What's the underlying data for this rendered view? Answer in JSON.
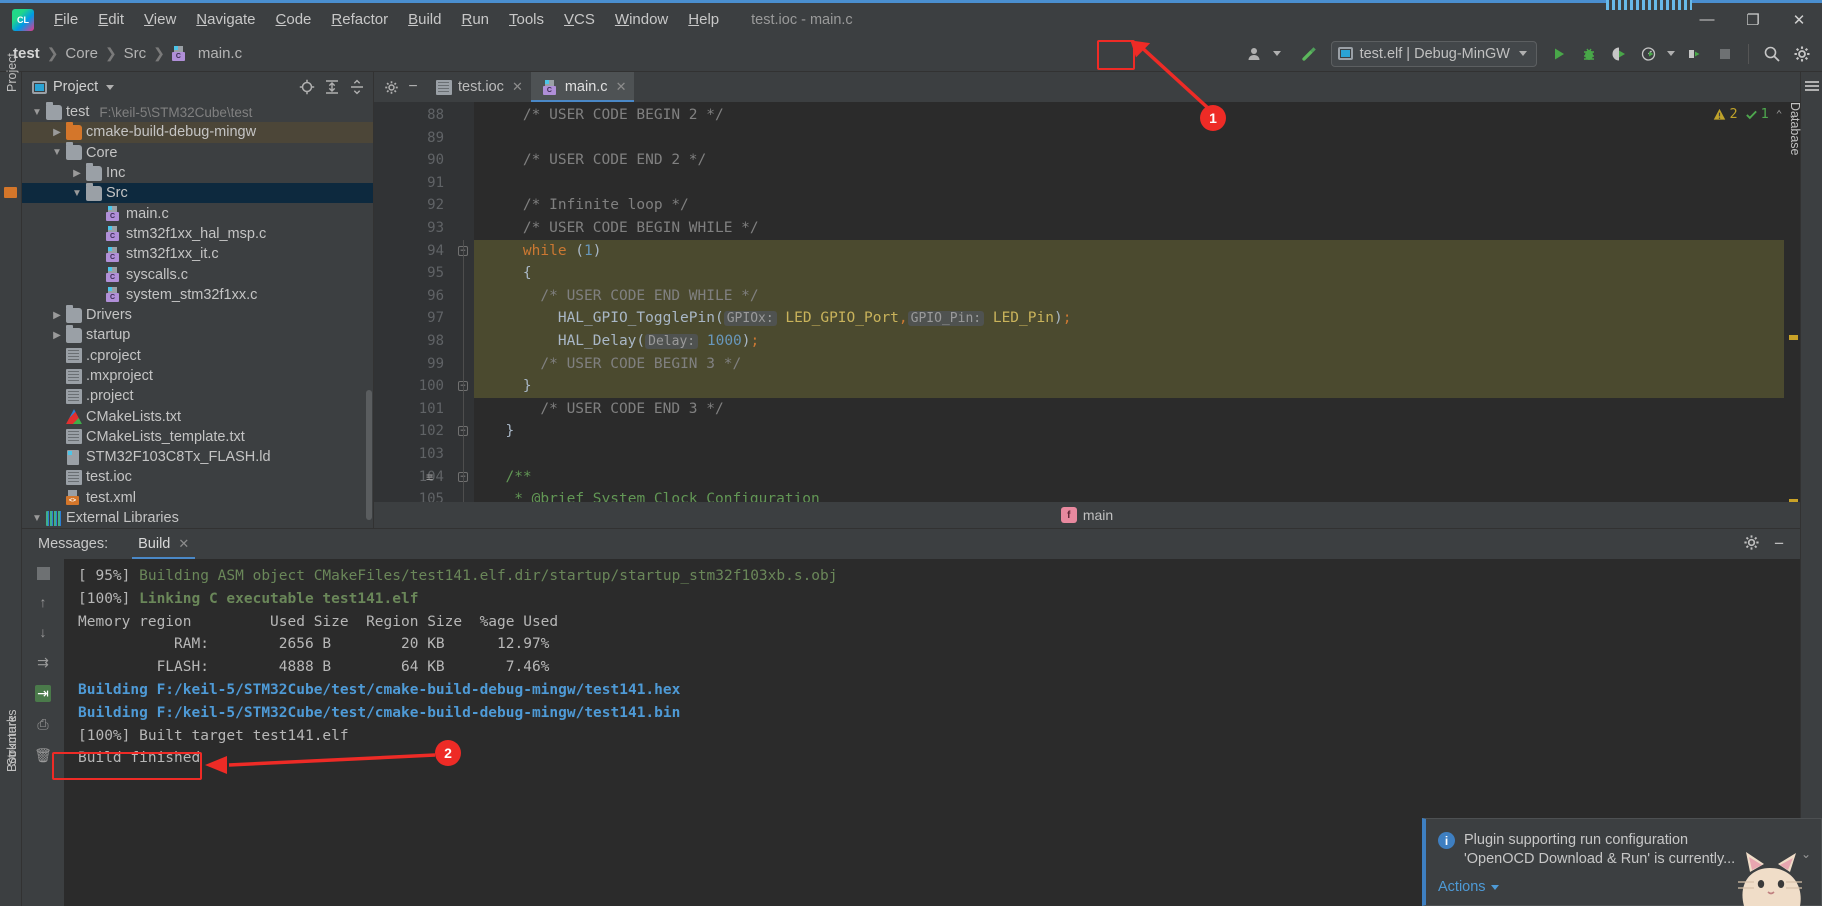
{
  "window": {
    "title": "test.ioc - main.c",
    "minimize": "—",
    "maximize": "❐",
    "close": "✕"
  },
  "menu": {
    "items": [
      "File",
      "Edit",
      "View",
      "Navigate",
      "Code",
      "Refactor",
      "Build",
      "Run",
      "Tools",
      "VCS",
      "Window",
      "Help"
    ]
  },
  "toolbar": {
    "breadcrumbs": [
      "test",
      "Core",
      "Src",
      "main.c"
    ],
    "run_config": "test.elf | Debug-MinGW",
    "icons": {
      "user_icon": "user-avatar",
      "build_hammer": "hammer-icon",
      "run": "run-icon",
      "debug": "debug-icon",
      "run_coverage": "run-with-coverage-icon",
      "profile": "profiler-icon",
      "attach": "attach-icon",
      "stop": "stop-icon",
      "search": "search-icon",
      "settings": "gear-icon"
    }
  },
  "sidebar_left": {
    "labels": [
      "Project",
      "Structure",
      "Bookmarks"
    ]
  },
  "sidebar_right": {
    "labels": [
      "Database"
    ]
  },
  "project_panel": {
    "title": "Project",
    "tree": [
      {
        "label": "test",
        "path": "F:\\keil-5\\STM32Cube\\test",
        "icon": "folder",
        "indent": 0,
        "arrow": "v",
        "state": "normal"
      },
      {
        "label": "cmake-build-debug-mingw",
        "path": "",
        "icon": "folder-orange",
        "indent": 1,
        "arrow": ">",
        "state": "highlight"
      },
      {
        "label": "Core",
        "path": "",
        "icon": "folder",
        "indent": 1,
        "arrow": "v",
        "state": "normal"
      },
      {
        "label": "Inc",
        "path": "",
        "icon": "folder",
        "indent": 2,
        "arrow": ">",
        "state": "normal"
      },
      {
        "label": "Src",
        "path": "",
        "icon": "folder",
        "indent": 2,
        "arrow": "v",
        "state": "selected"
      },
      {
        "label": "main.c",
        "path": "",
        "icon": "c-file",
        "indent": 3,
        "arrow": "",
        "state": "normal"
      },
      {
        "label": "stm32f1xx_hal_msp.c",
        "path": "",
        "icon": "c-file",
        "indent": 3,
        "arrow": "",
        "state": "normal"
      },
      {
        "label": "stm32f1xx_it.c",
        "path": "",
        "icon": "c-file",
        "indent": 3,
        "arrow": "",
        "state": "normal"
      },
      {
        "label": "syscalls.c",
        "path": "",
        "icon": "c-file",
        "indent": 3,
        "arrow": "",
        "state": "normal"
      },
      {
        "label": "system_stm32f1xx.c",
        "path": "",
        "icon": "c-file",
        "indent": 3,
        "arrow": "",
        "state": "normal"
      },
      {
        "label": "Drivers",
        "path": "",
        "icon": "folder",
        "indent": 1,
        "arrow": ">",
        "state": "normal"
      },
      {
        "label": "startup",
        "path": "",
        "icon": "folder",
        "indent": 1,
        "arrow": ">",
        "state": "normal"
      },
      {
        "label": ".cproject",
        "path": "",
        "icon": "txt-file",
        "indent": 1,
        "arrow": "",
        "state": "normal"
      },
      {
        "label": ".mxproject",
        "path": "",
        "icon": "txt-file",
        "indent": 1,
        "arrow": "",
        "state": "normal"
      },
      {
        "label": ".project",
        "path": "",
        "icon": "txt-file",
        "indent": 1,
        "arrow": "",
        "state": "normal"
      },
      {
        "label": "CMakeLists.txt",
        "path": "",
        "icon": "cmake-file",
        "indent": 1,
        "arrow": "",
        "state": "normal"
      },
      {
        "label": "CMakeLists_template.txt",
        "path": "",
        "icon": "txt-file",
        "indent": 1,
        "arrow": "",
        "state": "normal"
      },
      {
        "label": "STM32F103C8Tx_FLASH.ld",
        "path": "",
        "icon": "ld-file",
        "indent": 1,
        "arrow": "",
        "state": "normal"
      },
      {
        "label": "test.ioc",
        "path": "",
        "icon": "txt-file",
        "indent": 1,
        "arrow": "",
        "state": "normal"
      },
      {
        "label": "test.xml",
        "path": "",
        "icon": "xml-file",
        "indent": 1,
        "arrow": "",
        "state": "normal"
      },
      {
        "label": "External Libraries",
        "path": "",
        "icon": "library",
        "indent": 0,
        "arrow": "v",
        "state": "normal"
      }
    ]
  },
  "editor": {
    "tabs": [
      {
        "label": "test.ioc",
        "icon": "ioc-file-icon",
        "active": false
      },
      {
        "label": "main.c",
        "icon": "c-file-icon",
        "active": true
      }
    ],
    "inspection": {
      "warnings": "2",
      "ok": "1",
      "warn_icon": "warning-triangle-icon",
      "ok_icon": "check-icon"
    },
    "breadcrumb_symbol": "main",
    "first_line": 88,
    "lines": [
      {
        "n": 88,
        "indent": 4,
        "tokens": [
          {
            "t": "/* USER CODE BEGIN 2 */",
            "c": "cmt"
          }
        ]
      },
      {
        "n": 89,
        "indent": 0,
        "tokens": []
      },
      {
        "n": 90,
        "indent": 4,
        "tokens": [
          {
            "t": "/* USER CODE END 2 */",
            "c": "cmt"
          }
        ]
      },
      {
        "n": 91,
        "indent": 0,
        "tokens": []
      },
      {
        "n": 92,
        "indent": 4,
        "tokens": [
          {
            "t": "/* Infinite loop */",
            "c": "cmt"
          }
        ]
      },
      {
        "n": 93,
        "indent": 4,
        "tokens": [
          {
            "t": "/* USER CODE BEGIN WHILE */",
            "c": "cmt"
          }
        ]
      },
      {
        "n": 94,
        "indent": 4,
        "tokens": [
          {
            "t": "while",
            "c": "kw"
          },
          {
            "t": " (",
            "c": "punc"
          },
          {
            "t": "1",
            "c": "num"
          },
          {
            "t": ")",
            "c": "punc"
          }
        ]
      },
      {
        "n": 95,
        "indent": 4,
        "tokens": [
          {
            "t": "{",
            "c": "punc"
          }
        ]
      },
      {
        "n": 96,
        "indent": 6,
        "tokens": [
          {
            "t": "/* USER CODE END WHILE */",
            "c": "cmt"
          }
        ]
      },
      {
        "n": 97,
        "indent": 8,
        "tokens": [
          {
            "t": "HAL_GPIO_TogglePin",
            "c": "fn"
          },
          {
            "t": "(",
            "c": "punc"
          },
          {
            "t": "GPIOx:",
            "c": "hint"
          },
          {
            "t": "LED_GPIO_Port",
            "c": "const"
          },
          {
            "t": ",",
            "c": "kw"
          },
          {
            "t": "GPIO_Pin:",
            "c": "hint"
          },
          {
            "t": "LED_Pin",
            "c": "const"
          },
          {
            "t": ")",
            "c": "punc"
          },
          {
            "t": ";",
            "c": "kw"
          }
        ]
      },
      {
        "n": 98,
        "indent": 8,
        "tokens": [
          {
            "t": "HAL_Delay",
            "c": "fn"
          },
          {
            "t": "(",
            "c": "punc"
          },
          {
            "t": "Delay:",
            "c": "hint"
          },
          {
            "t": "1000",
            "c": "num"
          },
          {
            "t": ")",
            "c": "punc"
          },
          {
            "t": ";",
            "c": "kw"
          }
        ]
      },
      {
        "n": 99,
        "indent": 6,
        "tokens": [
          {
            "t": "/* USER CODE BEGIN 3 */",
            "c": "cmt"
          }
        ]
      },
      {
        "n": 100,
        "indent": 4,
        "tokens": [
          {
            "t": "}",
            "c": "punc"
          }
        ]
      },
      {
        "n": 101,
        "indent": 6,
        "tokens": [
          {
            "t": "/* USER CODE END 3 */",
            "c": "cmt"
          }
        ]
      },
      {
        "n": 102,
        "indent": 2,
        "tokens": [
          {
            "t": "}",
            "c": "punc"
          }
        ]
      },
      {
        "n": 103,
        "indent": 0,
        "tokens": []
      },
      {
        "n": 104,
        "indent": 2,
        "tokens": [
          {
            "t": "/**",
            "c": "docm"
          }
        ]
      },
      {
        "n": 105,
        "indent": 3,
        "tokens": [
          {
            "t": "* ",
            "c": "docm"
          },
          {
            "t": "@brief",
            "c": "docm-u"
          },
          {
            "t": " System Clock Configuration",
            "c": "docm"
          }
        ]
      }
    ]
  },
  "build_panel": {
    "messages_label": "Messages:",
    "tab_label": "Build",
    "gear_icon": "gear-icon",
    "minimize_icon": "minimize-icon",
    "lines": [
      {
        "parts": [
          {
            "t": "[ 95%] ",
            "c": "c-plain"
          },
          {
            "t": "Building ASM object CMakeFiles/test141.elf.dir/startup/startup_stm32f103xb.s.obj",
            "c": "c-green"
          }
        ]
      },
      {
        "parts": [
          {
            "t": "[100%] ",
            "c": "c-plain"
          },
          {
            "t": "Linking C executable test141.elf",
            "c": "c-greenb"
          }
        ]
      },
      {
        "parts": [
          {
            "t": "Memory region         Used Size  Region Size  %age Used",
            "c": "c-plain"
          }
        ]
      },
      {
        "parts": [
          {
            "t": "           RAM:        2656 B        20 KB      12.97%",
            "c": "c-plain"
          }
        ]
      },
      {
        "parts": [
          {
            "t": "         FLASH:        4888 B        64 KB       7.46%",
            "c": "c-plain"
          }
        ]
      },
      {
        "parts": [
          {
            "t": "Building F:/keil-5/STM32Cube/test/cmake-build-debug-mingw/test141.hex",
            "c": "c-blue"
          }
        ]
      },
      {
        "parts": [
          {
            "t": "Building F:/keil-5/STM32Cube/test/cmake-build-debug-mingw/test141.bin",
            "c": "c-blue"
          }
        ]
      },
      {
        "parts": [
          {
            "t": "[100%] Built target test141.elf",
            "c": "c-plain"
          }
        ]
      },
      {
        "parts": [
          {
            "t": "",
            "c": "c-plain"
          }
        ]
      },
      {
        "parts": [
          {
            "t": "Build finished",
            "c": "c-plain"
          }
        ]
      }
    ]
  },
  "notification": {
    "icon": "info-icon",
    "line1": "Plugin supporting run configuration",
    "line2": "'OpenOCD Download & Run' is currently...",
    "actions_label": "Actions",
    "collapse_icon": "chevron-down-icon"
  },
  "annotations": [
    {
      "id": "1",
      "label": "1"
    },
    {
      "id": "2",
      "label": "2"
    }
  ],
  "colors": {
    "accent_red": "#ee2b26",
    "tab_underline": "#4a88c7",
    "selection_blue": "#0d293e",
    "code_highlight": "#4b4a2f"
  }
}
